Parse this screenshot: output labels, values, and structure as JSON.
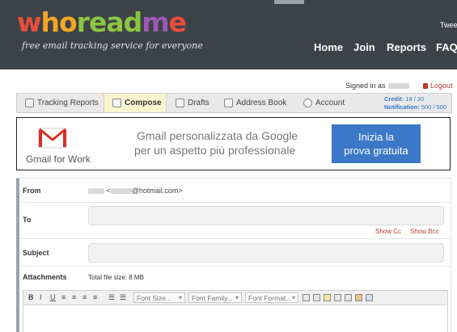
{
  "header": {
    "logo_parts": [
      "w",
      "ho",
      "read",
      "m",
      "e"
    ],
    "tagline": "free email tracking service for everyone",
    "tweet_label": "Twee",
    "nav": {
      "home": "Home",
      "join": "Join",
      "reports": "Reports",
      "faq": "FAQ"
    }
  },
  "account": {
    "signed_in_label": "Signed in as",
    "logout_label": "Logout"
  },
  "tabs": {
    "tracking_reports": "Tracking Reports",
    "compose": "Compose",
    "drafts": "Drafts",
    "address_book": "Address Book",
    "account": "Account"
  },
  "status": {
    "credit_label": "Credit:",
    "credit_value": "18 / 20",
    "notification_label": "Notification:",
    "notification_value": "500 / 500"
  },
  "banner": {
    "product": "Gmail for Work",
    "line1": "Gmail personalizzata da Google",
    "line2": "per un aspetto più professionale",
    "cta_line1": "Inizia la",
    "cta_line2": "prova gratuita"
  },
  "form": {
    "from_label": "From",
    "from_domain": "@hotmail.com>",
    "to_label": "To",
    "show_cc": "Show Cc",
    "show_bcc": "Show Bcc",
    "subject_label": "Subject",
    "attachments_label": "Attachments",
    "total_file_size": "Total file size: 8 MB"
  },
  "editor": {
    "font_size": "Font Size...",
    "font_family": "Font Family...",
    "font_format": "Font Format..."
  }
}
